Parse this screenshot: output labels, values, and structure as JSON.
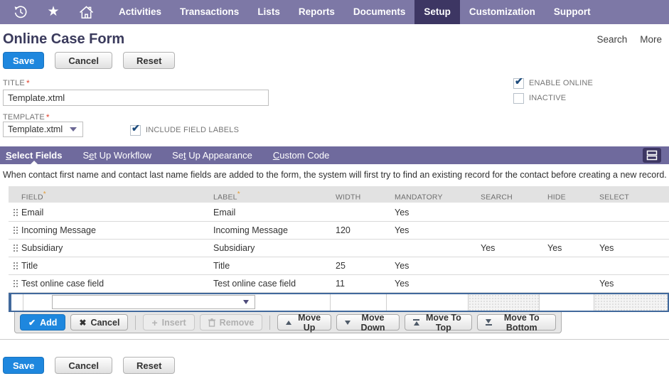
{
  "nav": {
    "icons": [
      {
        "name": "history-icon"
      },
      {
        "name": "star-icon"
      },
      {
        "name": "home-icon"
      }
    ],
    "items": [
      {
        "label": "Activities",
        "active": false
      },
      {
        "label": "Transactions",
        "active": false
      },
      {
        "label": "Lists",
        "active": false
      },
      {
        "label": "Reports",
        "active": false
      },
      {
        "label": "Documents",
        "active": false
      },
      {
        "label": "Setup",
        "active": true
      },
      {
        "label": "Customization",
        "active": false
      },
      {
        "label": "Support",
        "active": false
      }
    ]
  },
  "header": {
    "title": "Online Case Form",
    "links": {
      "search": "Search",
      "more": "More"
    }
  },
  "actions": {
    "save": "Save",
    "cancel": "Cancel",
    "reset": "Reset"
  },
  "form": {
    "title": {
      "label": "TITLE",
      "required": "*",
      "value": "Template.xtml"
    },
    "template": {
      "label": "TEMPLATE",
      "required": "*",
      "value": "Template.xtml"
    },
    "checkboxes": {
      "enable_online": {
        "label": "ENABLE ONLINE",
        "checked": true
      },
      "inactive": {
        "label": "INACTIVE",
        "checked": false
      },
      "include_field_labels": {
        "label": "INCLUDE FIELD LABELS",
        "checked": true
      }
    }
  },
  "tabs": [
    {
      "label": "Select Fields",
      "underline_index": 0,
      "active": true
    },
    {
      "label": "Set Up Workflow",
      "underline_index": 1,
      "active": false
    },
    {
      "label": "Set Up Appearance",
      "underline_index": 2,
      "active": false
    },
    {
      "label": "Custom Code",
      "underline_index": 0,
      "active": false
    }
  ],
  "info_text": "When contact first name and contact last name fields are added to the form, the system will first try to find an existing record for the contact before creating a new record.",
  "sublist": {
    "columns": [
      {
        "key": "field",
        "label": "FIELD",
        "required": true
      },
      {
        "key": "label",
        "label": "LABEL",
        "required": true
      },
      {
        "key": "width",
        "label": "WIDTH",
        "required": false
      },
      {
        "key": "mandatory",
        "label": "MANDATORY",
        "required": false
      },
      {
        "key": "search",
        "label": "SEARCH",
        "required": false
      },
      {
        "key": "hide",
        "label": "HIDE",
        "required": false
      },
      {
        "key": "select",
        "label": "SELECT",
        "required": false
      }
    ],
    "rows": [
      {
        "field": "Email",
        "label": "Email",
        "width": "",
        "mandatory": "Yes",
        "search": "",
        "hide": "",
        "select": ""
      },
      {
        "field": "Incoming Message",
        "label": "Incoming Message",
        "width": "120",
        "mandatory": "Yes",
        "search": "",
        "hide": "",
        "select": ""
      },
      {
        "field": "Subsidiary",
        "label": "Subsidiary",
        "width": "",
        "mandatory": "",
        "search": "Yes",
        "hide": "Yes",
        "select": "Yes"
      },
      {
        "field": "Title",
        "label": "Title",
        "width": "25",
        "mandatory": "Yes",
        "search": "",
        "hide": "",
        "select": ""
      },
      {
        "field": "Test online case field",
        "label": "Test online case field",
        "width": "11",
        "mandatory": "Yes",
        "search": "",
        "hide": "",
        "select": "Yes"
      }
    ],
    "edit_row": {
      "field_value": ""
    },
    "toolbar": {
      "add": "Add",
      "cancel": "Cancel",
      "insert": "Insert",
      "remove": "Remove",
      "move_up": "Move Up",
      "move_down": "Move Down",
      "move_to_top": "Move To Top",
      "move_to_bottom": "Move To Bottom"
    }
  },
  "colors": {
    "nav_purple": "#7d78a6",
    "dark_purple": "#3d3663",
    "tabbar_purple": "#6f6a9d",
    "primary_blue": "#1e87de",
    "edit_row_border": "#41699c",
    "required_red": "#e0432f",
    "required_orange": "#e39b35"
  }
}
